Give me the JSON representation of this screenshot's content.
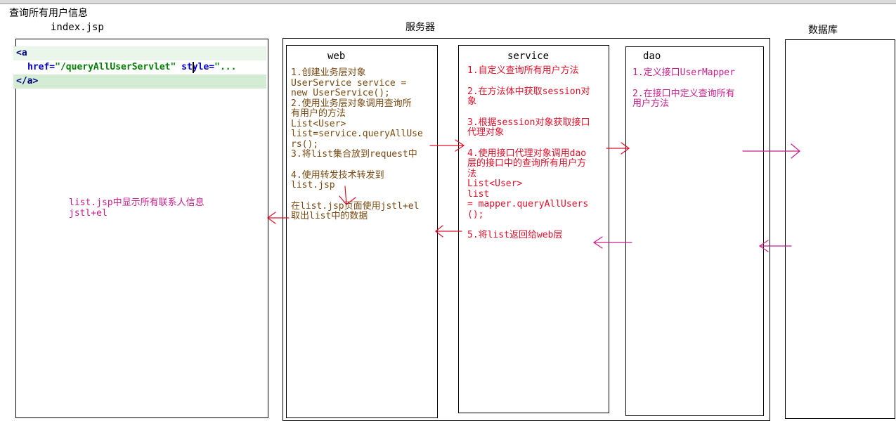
{
  "page_title": "查询所有用户信息",
  "index_panel": {
    "title": "index.jsp",
    "code": {
      "line1": "<a",
      "line2_attr": "href=",
      "line2_value": "\"/queryAllUserServlet\"",
      "line2_attr2": " style=",
      "line2_rest": "\"...",
      "line3": "</a>"
    },
    "note_line1": "list.jsp中显示所有联系人信息",
    "note_line2": "jstl+el"
  },
  "server_label": "服务器",
  "database_label": "数据库",
  "web_box": {
    "title": "web",
    "steps": [
      "1.创建业务层对象",
      "UserService service =",
      "new UserService();",
      "2.使用业务层对象调用查询所",
      "有用户的方法",
      "List<User>",
      "list=service.queryAllUse",
      "rs();",
      "3.将list集合放到request中",
      "4.使用转发技术转发到",
      "list.jsp",
      "在list.jsp页面使用jstl+el",
      "取出list中的数据"
    ]
  },
  "service_box": {
    "title": "service",
    "steps": [
      "1.自定义查询所有用户方法",
      "2.在方法体中获取session对",
      "象",
      "3.根据session对象获取接口",
      "代理对象",
      "4.使用接口代理对象调用dao",
      "层的接口中的查询所有用户方",
      "法",
      "List<User>",
      "list",
      "= mapper.queryAllUsers",
      "();",
      "5.将list返回给web层"
    ]
  },
  "dao_box": {
    "title": "dao",
    "steps": [
      "1.定义接口UserMapper",
      "2.在接口中定义查询所有",
      "用户方法"
    ]
  },
  "colors": {
    "brown_text": "#7a4a12",
    "red_text": "#e0102a",
    "magenta_text": "#c81e8c",
    "code_highlight": "#d4ecd4",
    "arrow": "#e0102a"
  }
}
